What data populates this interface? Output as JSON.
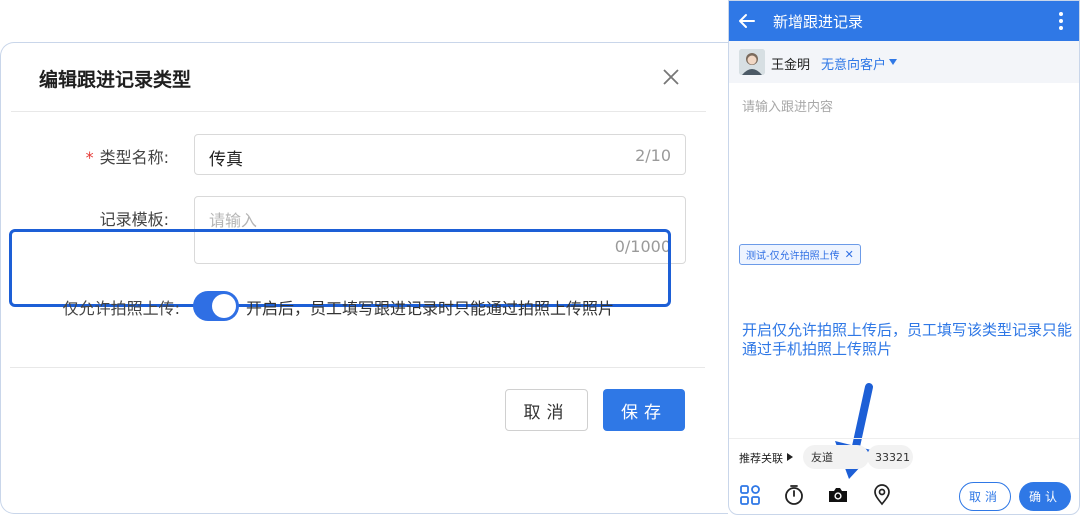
{
  "dialog": {
    "title": "编辑跟进记录类型",
    "type_name": {
      "required_mark": "*",
      "label": "类型名称:",
      "value": "传真",
      "counter": "2/10"
    },
    "template": {
      "label": "记录模板:",
      "placeholder": "请输入",
      "counter": "0/1000"
    },
    "photo_only": {
      "label": "仅允许拍照上传:",
      "enabled": true,
      "description": "开启后，员工填写跟进记录时只能通过拍照上传照片"
    },
    "cancel_label": "取消",
    "save_label": "保存"
  },
  "phone": {
    "title": "新增跟进记录",
    "user_name": "王金明",
    "customer_type": "无意向客户",
    "content_placeholder": "请输入跟进内容",
    "tag_label": "测试-仅允许拍照上传",
    "annotation": "开启仅允许拍照上传后，员工填写该类型记录只能通过手机拍照上传照片",
    "recommend_label": "推荐关联",
    "chips": [
      "友道",
      "33321"
    ],
    "cancel_label": "取消",
    "confirm_label": "确认"
  },
  "colors": {
    "accent": "#2f78e6",
    "highlight_border": "#1d5fd6",
    "required": "#e53935"
  },
  "icons": [
    "close-icon",
    "back-arrow-icon",
    "more-vert-icon",
    "apps-grid-icon",
    "timer-icon",
    "camera-icon",
    "location-pin-icon",
    "pointer-arrow-icon"
  ]
}
